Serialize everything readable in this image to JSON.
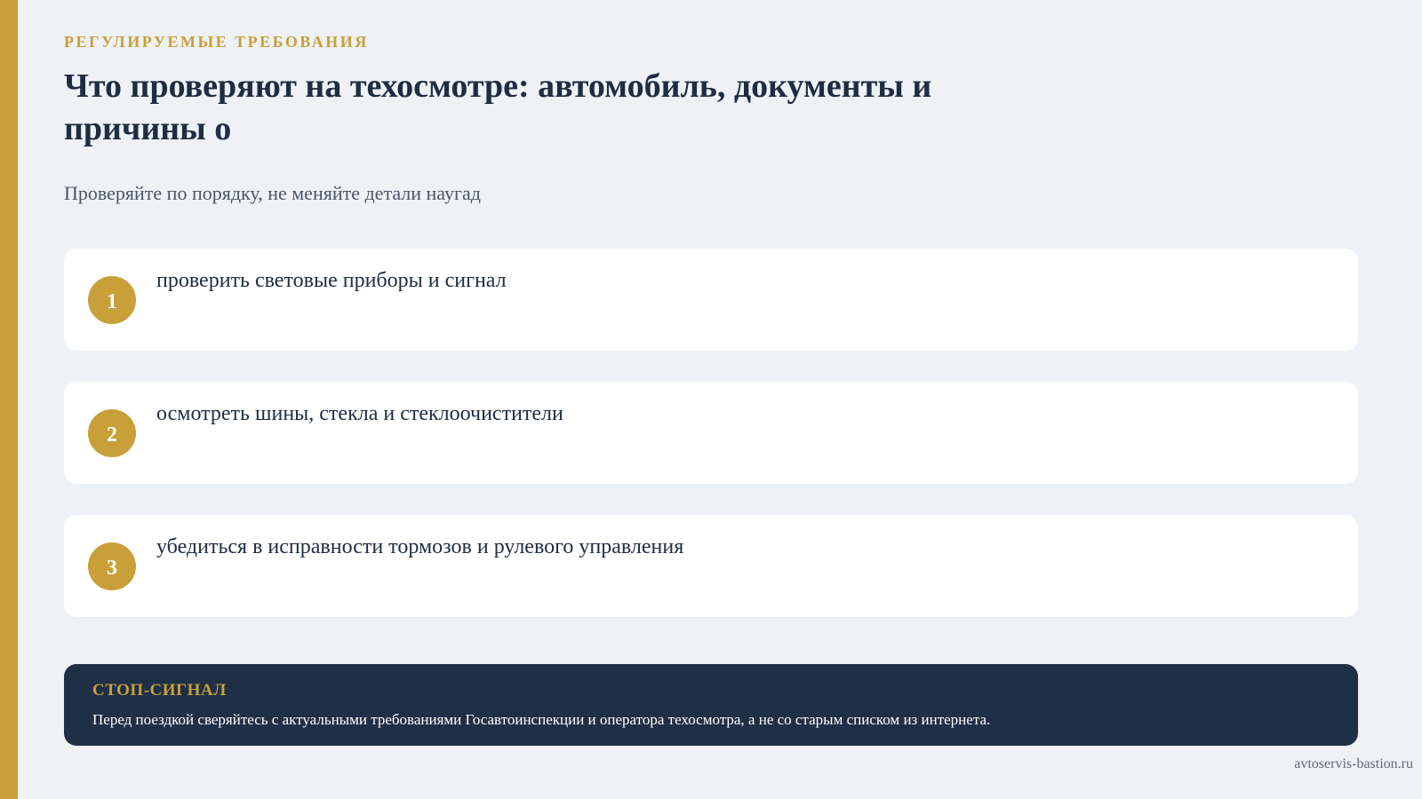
{
  "header": {
    "eyebrow": "РЕГУЛИРУЕМЫЕ ТРЕБОВАНИЯ",
    "title": "Что проверяют на техосмотре: автомобиль, документы и причины о",
    "subtitle": "Проверяйте по порядку, не меняйте детали наугад"
  },
  "steps": [
    {
      "number": "1",
      "text": "проверить световые приборы и сигнал"
    },
    {
      "number": "2",
      "text": "осмотреть шины, стекла и стеклоочистители"
    },
    {
      "number": "3",
      "text": "убедиться в исправности тормозов и рулевого управления"
    }
  ],
  "alert": {
    "title": "СТОП-СИГНАЛ",
    "text": "Перед поездкой сверяйтесь с актуальными требованиями Госавтоинспекции и оператора техосмотра, а не со старым списком из интернета."
  },
  "footer": {
    "site": "avtoservis-bastion.ru"
  },
  "colors": {
    "accent": "#c99f3a",
    "dark": "#1f2f46",
    "background": "#eef2f6"
  }
}
